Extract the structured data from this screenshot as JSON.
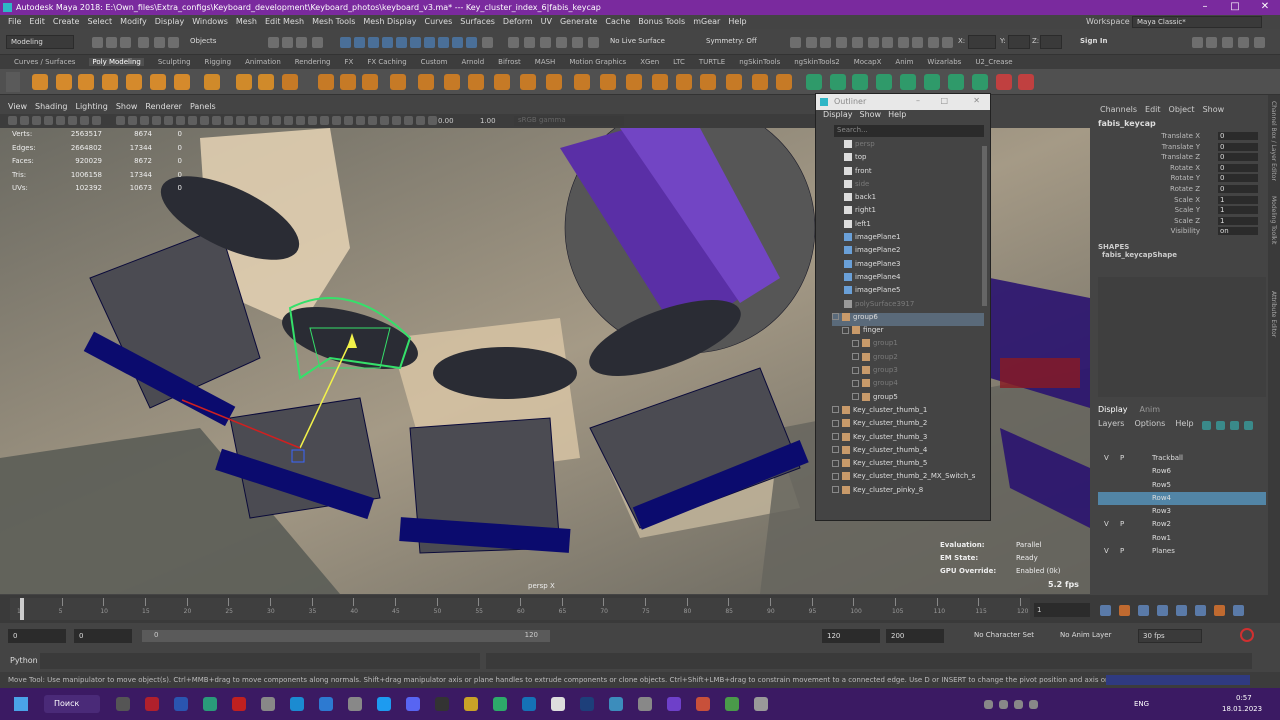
{
  "title": "Autodesk Maya 2018: E:\\Own_files\\Extra_configs\\Keyboard_development\\Keyboard_photos\\keyboard_v3.ma*   ---  Key_cluster_index_6|fabis_keycap",
  "menu": [
    "File",
    "Edit",
    "Create",
    "Select",
    "Modify",
    "Display",
    "Windows",
    "Mesh",
    "Edit Mesh",
    "Mesh Tools",
    "Mesh Display",
    "Curves",
    "Surfaces",
    "Deform",
    "UV",
    "Generate",
    "Cache",
    "Bonus Tools",
    "mGear",
    "Help"
  ],
  "workspace": {
    "label": "Workspace :",
    "value": "Maya Classic*"
  },
  "status": {
    "mode": "Modeling",
    "objects": "Objects",
    "live": "No Live Surface",
    "symmetry": "Symmetry: Off",
    "signin": "Sign In",
    "x": "X:",
    "y": "Y:",
    "z": "Z:"
  },
  "shelf_tabs": [
    "Curves / Surfaces",
    "Poly Modeling",
    "Sculpting",
    "Rigging",
    "Animation",
    "Rendering",
    "FX",
    "FX Caching",
    "Custom",
    "Arnold",
    "Bifrost",
    "MASH",
    "Motion Graphics",
    "XGen",
    "LTC",
    "TURTLE",
    "ngSkinTools",
    "ngSkinTools2",
    "MocapX",
    "Anim",
    "Wizarlabs",
    "U2_Crease"
  ],
  "viewport_menu": [
    "View",
    "Shading",
    "Lighting",
    "Show",
    "Renderer",
    "Panels"
  ],
  "viewport_fields": {
    "a": "0.00",
    "b": "1.00",
    "c": "sRGB gamma"
  },
  "hud_stats": [
    [
      "Verts:",
      "2563517",
      "8674",
      "0"
    ],
    [
      "Edges:",
      "2664802",
      "17344",
      "0"
    ],
    [
      "Faces:",
      "920029",
      "8672",
      "0"
    ],
    [
      "Tris:",
      "1006158",
      "17344",
      "0"
    ],
    [
      "UVs:",
      "102392",
      "10673",
      "0"
    ]
  ],
  "hud_bottom": [
    [
      "Evaluation:",
      "Parallel"
    ],
    [
      "EM State:",
      "Ready"
    ],
    [
      "GPU Override:",
      "Enabled (0k)"
    ]
  ],
  "fps": "5.2 fps",
  "camera": "persp X",
  "outliner": {
    "title": "Outliner",
    "menu": [
      "Display",
      "Show",
      "Help"
    ],
    "search": "Search...",
    "items": [
      {
        "name": "persp",
        "dim": true,
        "indent": 0,
        "type": "cam"
      },
      {
        "name": "top",
        "dim": false,
        "indent": 0,
        "type": "cam"
      },
      {
        "name": "front",
        "dim": false,
        "indent": 0,
        "type": "cam"
      },
      {
        "name": "side",
        "dim": true,
        "indent": 0,
        "type": "cam"
      },
      {
        "name": "back1",
        "dim": false,
        "indent": 0,
        "type": "cam"
      },
      {
        "name": "right1",
        "dim": false,
        "indent": 0,
        "type": "cam"
      },
      {
        "name": "left1",
        "dim": false,
        "indent": 0,
        "type": "cam"
      },
      {
        "name": "imagePlane1",
        "dim": false,
        "indent": 0,
        "type": "img"
      },
      {
        "name": "imagePlane2",
        "dim": false,
        "indent": 0,
        "type": "img"
      },
      {
        "name": "imagePlane3",
        "dim": false,
        "indent": 0,
        "type": "img"
      },
      {
        "name": "imagePlane4",
        "dim": false,
        "indent": 0,
        "type": "img"
      },
      {
        "name": "imagePlane5",
        "dim": false,
        "indent": 0,
        "type": "img"
      },
      {
        "name": "polySurface3917",
        "dim": true,
        "indent": 0,
        "type": "mesh"
      },
      {
        "name": "group6",
        "dim": false,
        "indent": 0,
        "type": "grp",
        "sel": true
      },
      {
        "name": "finger",
        "dim": false,
        "indent": 1,
        "type": "grp"
      },
      {
        "name": "group1",
        "dim": true,
        "indent": 2,
        "type": "grp"
      },
      {
        "name": "group2",
        "dim": true,
        "indent": 2,
        "type": "grp"
      },
      {
        "name": "group3",
        "dim": true,
        "indent": 2,
        "type": "grp"
      },
      {
        "name": "group4",
        "dim": true,
        "indent": 2,
        "type": "grp"
      },
      {
        "name": "group5",
        "dim": false,
        "indent": 2,
        "type": "grp"
      },
      {
        "name": "Key_cluster_thumb_1",
        "dim": false,
        "indent": 0,
        "type": "grp"
      },
      {
        "name": "Key_cluster_thumb_2",
        "dim": false,
        "indent": 0,
        "type": "grp"
      },
      {
        "name": "Key_cluster_thumb_3",
        "dim": false,
        "indent": 0,
        "type": "grp"
      },
      {
        "name": "Key_cluster_thumb_4",
        "dim": false,
        "indent": 0,
        "type": "grp"
      },
      {
        "name": "Key_cluster_thumb_5",
        "dim": false,
        "indent": 0,
        "type": "grp"
      },
      {
        "name": "Key_cluster_thumb_2_MX_Switch_s",
        "dim": false,
        "indent": 0,
        "type": "grp"
      },
      {
        "name": "Key_cluster_pinky_8",
        "dim": false,
        "indent": 0,
        "type": "grp"
      }
    ]
  },
  "channelbox": {
    "menu": [
      "Channels",
      "Edit",
      "Object",
      "Show"
    ],
    "object": "fabis_keycap",
    "attrs": [
      [
        "Translate X",
        "0"
      ],
      [
        "Translate Y",
        "0"
      ],
      [
        "Translate Z",
        "0"
      ],
      [
        "Rotate X",
        "0"
      ],
      [
        "Rotate Y",
        "0"
      ],
      [
        "Rotate Z",
        "0"
      ],
      [
        "Scale X",
        "1"
      ],
      [
        "Scale Y",
        "1"
      ],
      [
        "Scale Z",
        "1"
      ],
      [
        "Visibility",
        "on"
      ]
    ],
    "shapes_label": "SHAPES",
    "shape": "fabis_keycapShape"
  },
  "side_tabs": [
    "Channel Box / Layer Editor",
    "Modeling Toolkit",
    "Attribute Editor"
  ],
  "layers": {
    "tabs": [
      "Display",
      "Anim"
    ],
    "menu": [
      "Layers",
      "Options",
      "Help"
    ],
    "items": [
      {
        "v": "V",
        "p": "P",
        "name": "Trackball",
        "sel": false
      },
      {
        "v": "",
        "p": "",
        "name": "Row6",
        "sel": false
      },
      {
        "v": "",
        "p": "",
        "name": "Row5",
        "sel": false
      },
      {
        "v": "",
        "p": "",
        "name": "Row4",
        "sel": true
      },
      {
        "v": "",
        "p": "",
        "name": "Row3",
        "sel": false
      },
      {
        "v": "V",
        "p": "P",
        "name": "Row2",
        "sel": false
      },
      {
        "v": "",
        "p": "",
        "name": "Row1",
        "sel": false
      },
      {
        "v": "V",
        "p": "P",
        "name": "Planes",
        "sel": false
      }
    ]
  },
  "timeline": {
    "ticks": [
      "1",
      "5",
      "10",
      "15",
      "20",
      "25",
      "30",
      "35",
      "40",
      "45",
      "50",
      "55",
      "60",
      "65",
      "70",
      "75",
      "80",
      "85",
      "90",
      "95",
      "100",
      "105",
      "110",
      "115",
      "120"
    ],
    "current": "1"
  },
  "range": {
    "start": "0",
    "start2": "0",
    "slider_start": "0",
    "slider_end": "120",
    "end": "120",
    "end2": "200",
    "char": "No Character Set",
    "anim": "No Anim Layer",
    "fps": "30 fps"
  },
  "cmd_label": "Python",
  "help": "Move Tool: Use manipulator to move object(s). Ctrl+MMB+drag to move components along normals. Shift+drag manipulator axis or plane handles to extrude components or clone objects. Ctrl+Shift+LMB+drag to constrain movement to a connected edge. Use D or INSERT to change the pivot position and axis orientation.",
  "taskbar": {
    "search": "Поиск",
    "lang": "ENG",
    "time": "0:57",
    "date": "18.01.2023"
  }
}
